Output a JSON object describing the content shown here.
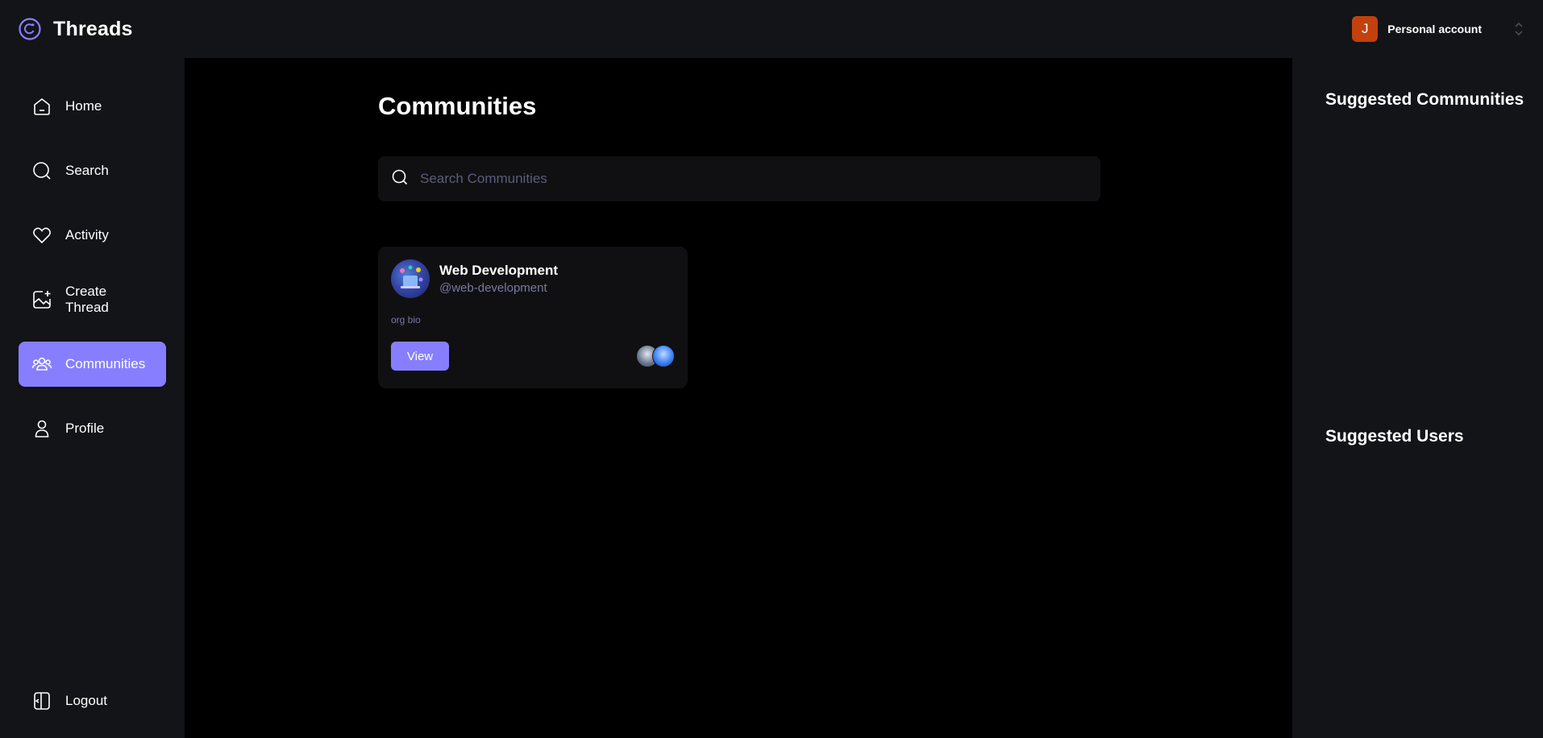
{
  "app": {
    "name": "Threads"
  },
  "account": {
    "initial": "J",
    "name": "Personal account"
  },
  "sidebar": {
    "items": [
      {
        "label": "Home",
        "icon": "home-icon"
      },
      {
        "label": "Search",
        "icon": "search-icon"
      },
      {
        "label": "Activity",
        "icon": "heart-icon"
      },
      {
        "label": "Create Thread",
        "icon": "create-thread-icon"
      },
      {
        "label": "Communities",
        "icon": "communities-icon",
        "active": true
      },
      {
        "label": "Profile",
        "icon": "user-icon"
      }
    ],
    "logout_label": "Logout"
  },
  "main": {
    "title": "Communities",
    "search": {
      "placeholder": "Search Communities",
      "value": ""
    },
    "communities": [
      {
        "name": "Web Development",
        "handle": "@web-development",
        "bio": "org bio",
        "view_label": "View"
      }
    ]
  },
  "rightbar": {
    "suggested_communities_title": "Suggested Communities",
    "suggested_users_title": "Suggested Users"
  },
  "colors": {
    "accent": "#877eff",
    "surface": "#121417",
    "background": "#000000",
    "muted_text": "#7878a3",
    "avatar": "#c2410c"
  }
}
